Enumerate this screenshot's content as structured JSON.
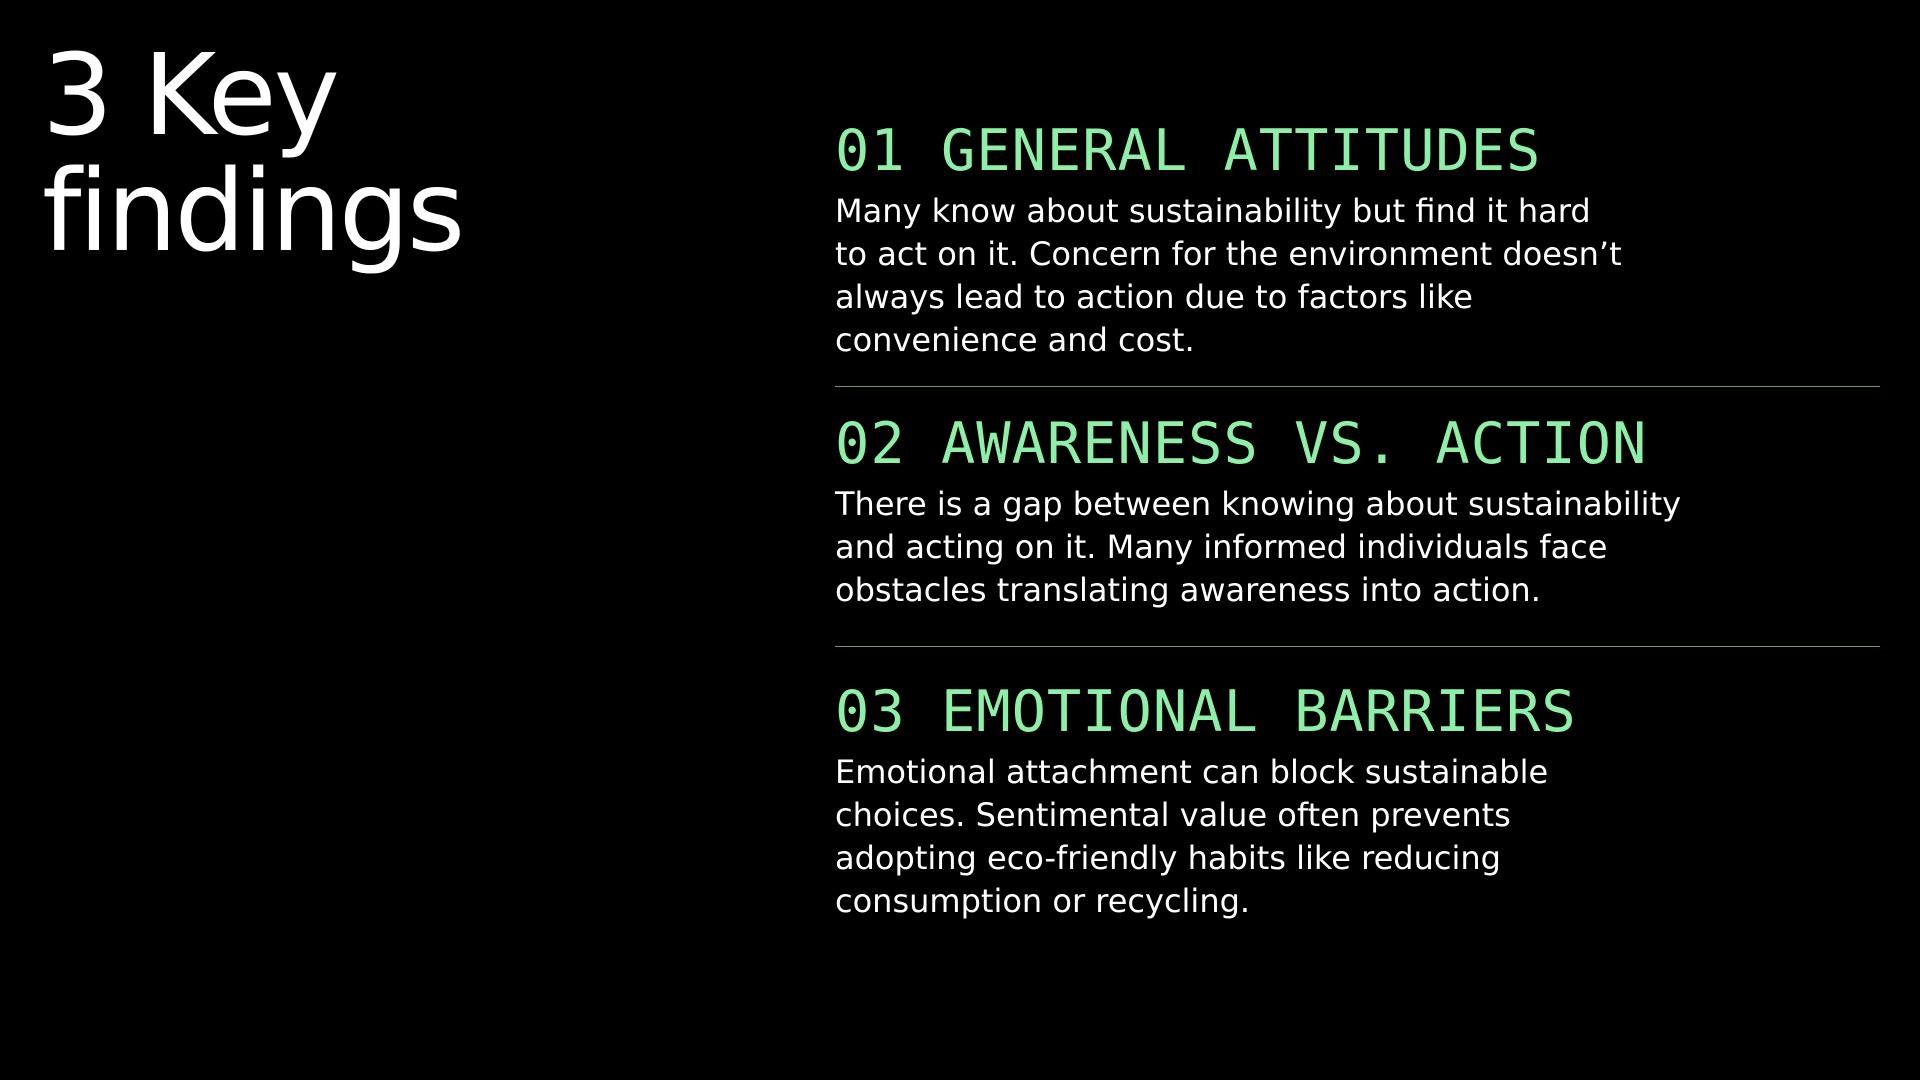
{
  "colors": {
    "background": "#000000",
    "text": "#ffffff",
    "accent": "#8ef0a6",
    "divider": "#6d9a79"
  },
  "title": {
    "line1": "3 Key",
    "line2": "findings"
  },
  "findings": [
    {
      "heading": "01 GENERAL ATTITUDES",
      "body": "Many know about sustainability but find it hard to act on it. Concern for the environment doesn’t always lead to action due to factors like convenience and cost."
    },
    {
      "heading": "02 AWARENESS VS. ACTION",
      "body": "There is a gap between knowing about sustainability and acting on it. Many informed individuals face obstacles translating awareness into action."
    },
    {
      "heading": "03 EMOTIONAL BARRIERS",
      "body": "Emotional attachment can block sustainable choices. Sentimental value often prevents adopting eco-friendly habits like reducing consumption or recycling."
    }
  ]
}
